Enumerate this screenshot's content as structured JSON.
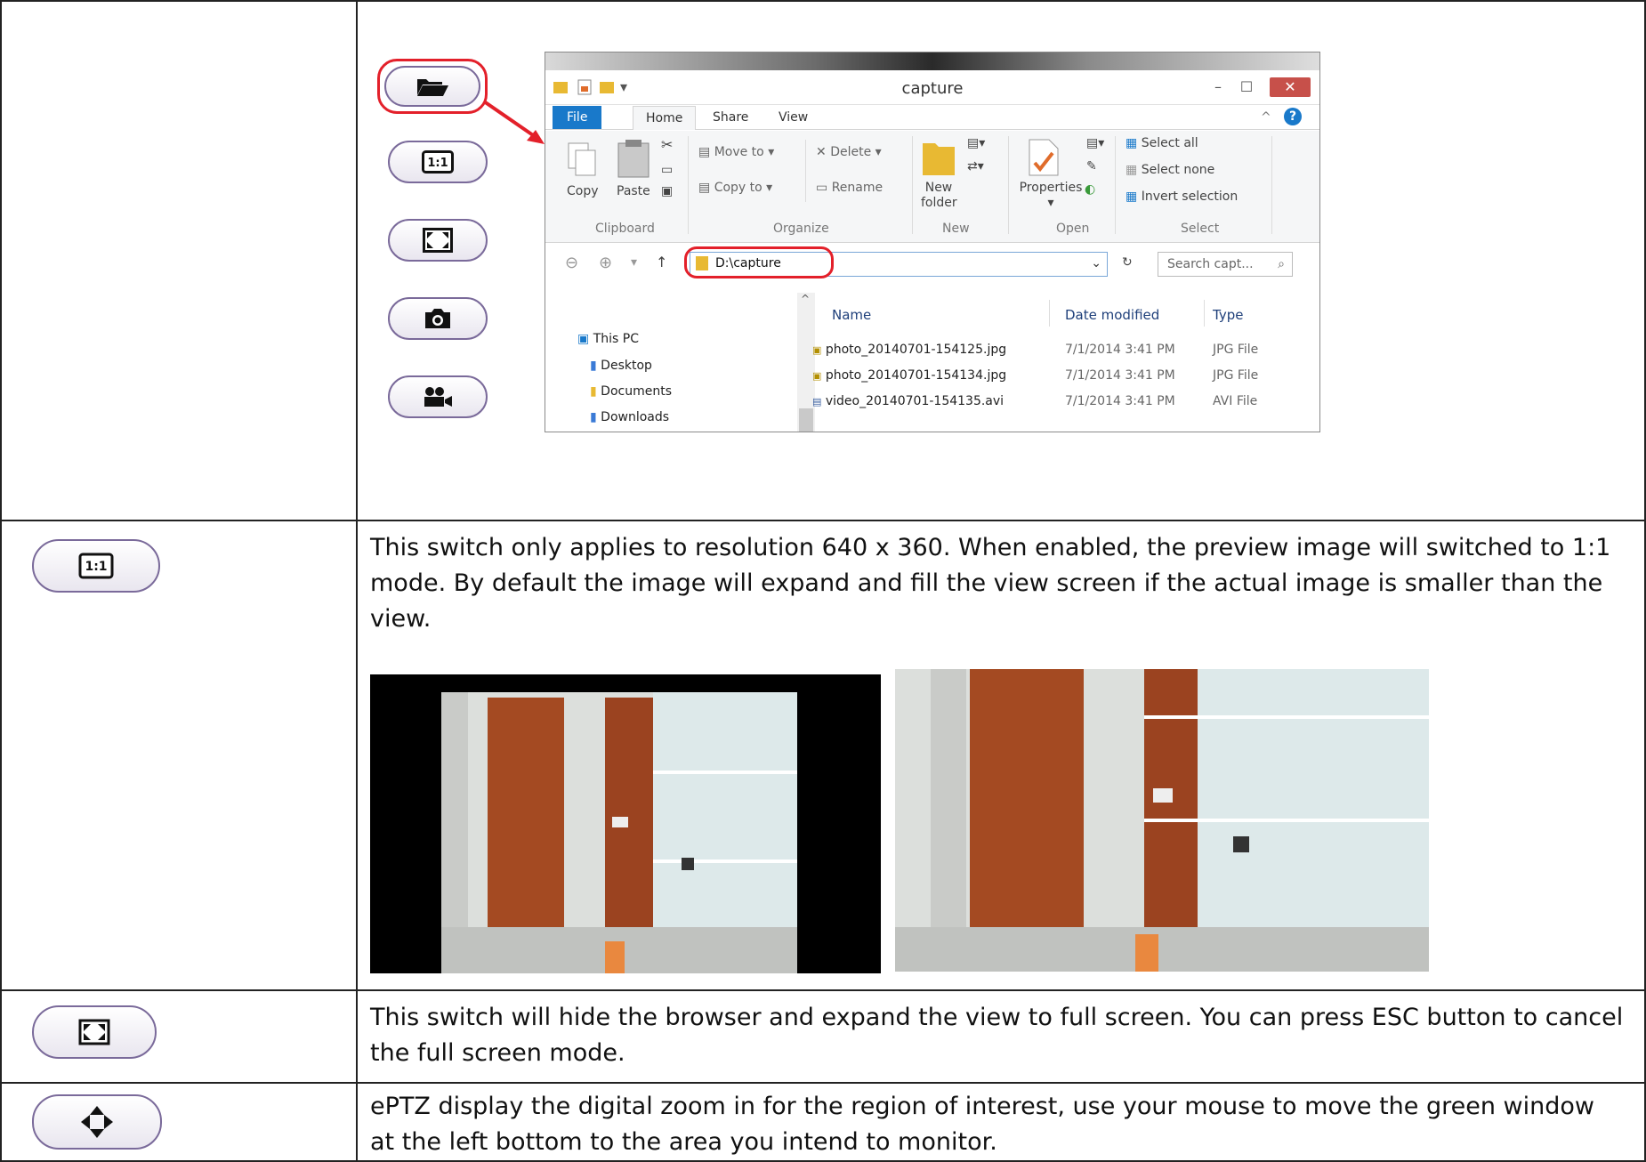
{
  "explorer": {
    "title": "capture",
    "tabs": [
      "File",
      "Home",
      "Share",
      "View"
    ],
    "ribbon": {
      "copy": "Copy",
      "paste": "Paste",
      "move_to": "Move to",
      "copy_to": "Copy to",
      "delete": "Delete",
      "rename": "Rename",
      "new_folder_1": "New",
      "new_folder_2": "folder",
      "properties": "Properties",
      "select_all": "Select all",
      "select_none": "Select none",
      "invert_selection": "Invert selection",
      "groups": [
        "Clipboard",
        "Organize",
        "New",
        "Open",
        "Select"
      ]
    },
    "address": "D:\\capture",
    "search_placeholder": "Search capt...",
    "nav_items": [
      "This PC",
      "Desktop",
      "Documents",
      "Downloads"
    ],
    "columns": [
      "Name",
      "Date modified",
      "Type"
    ],
    "files": [
      {
        "name": "photo_20140701-154125.jpg",
        "date": "7/1/2014 3:41 PM",
        "type": "JPG File"
      },
      {
        "name": "photo_20140701-154134.jpg",
        "date": "7/1/2014 3:41 PM",
        "type": "JPG File"
      },
      {
        "name": "video_20140701-154135.avi",
        "date": "7/1/2014 3:41 PM",
        "type": "AVI File"
      }
    ]
  },
  "rows": {
    "ratio": {
      "button_label": "1:1",
      "description": "This switch only applies to resolution 640 x 360. When enabled, the preview image will switched to 1:1 mode. By default the image will expand and fill the view screen if the actual image is smaller than the view."
    },
    "fullscreen": {
      "description": "This switch will hide the browser and expand the view to full screen. You can press ESC button to cancel the full screen mode."
    },
    "eptz": {
      "description": "ePTZ display the digital zoom in for the region of interest, use your mouse to move the green window at the left bottom to the area you intend to monitor."
    }
  },
  "icons": {
    "open_folder": "folder-open-icon",
    "ratio": "ratio-1-1-icon",
    "fullscreen": "fullscreen-icon",
    "camera": "camera-icon",
    "video": "video-camera-icon",
    "move": "move-arrows-icon"
  },
  "colors": {
    "highlight": "#e3202a",
    "pill_border": "#7a6a9a",
    "file_tab": "#1979ca"
  }
}
